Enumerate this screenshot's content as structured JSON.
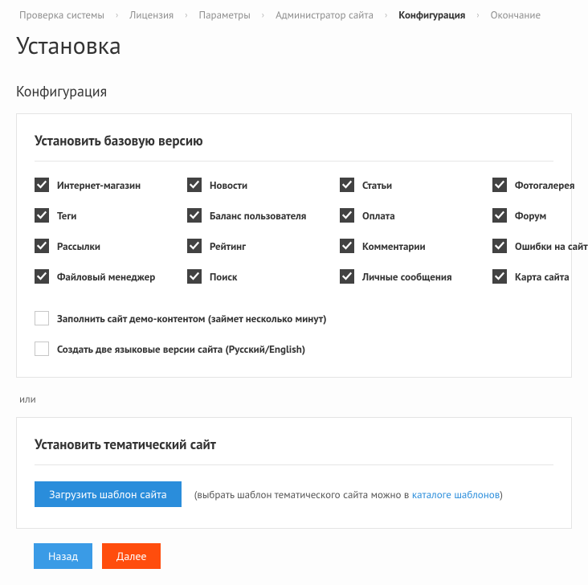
{
  "breadcrumb": [
    {
      "label": "Проверка системы",
      "active": false
    },
    {
      "label": "Лицензия",
      "active": false
    },
    {
      "label": "Параметры",
      "active": false
    },
    {
      "label": "Администратор сайта",
      "active": false
    },
    {
      "label": "Конфигурация",
      "active": true
    },
    {
      "label": "Окончание",
      "active": false
    }
  ],
  "page_title": "Установка",
  "section_title": "Конфигурация",
  "base_panel": {
    "title": "Установить базовую версию",
    "modules": [
      {
        "label": "Интернет-магазин",
        "checked": true
      },
      {
        "label": "Новости",
        "checked": true
      },
      {
        "label": "Статьи",
        "checked": true
      },
      {
        "label": "Фотогалерея",
        "checked": true
      },
      {
        "label": "Теги",
        "checked": true
      },
      {
        "label": "Баланс пользователя",
        "checked": true
      },
      {
        "label": "Оплата",
        "checked": true
      },
      {
        "label": "Форум",
        "checked": true
      },
      {
        "label": "Рассылки",
        "checked": true
      },
      {
        "label": "Рейтинг",
        "checked": true
      },
      {
        "label": "Комментарии",
        "checked": true
      },
      {
        "label": "Ошибки на сайте",
        "checked": true
      },
      {
        "label": "Файловый менеджер",
        "checked": true
      },
      {
        "label": "Поиск",
        "checked": true
      },
      {
        "label": "Личные сообщения",
        "checked": true
      },
      {
        "label": "Карта сайта",
        "checked": true
      }
    ],
    "extra": [
      {
        "label": "Заполнить сайт демо-контентом (займет несколько минут)",
        "checked": false
      },
      {
        "label": "Создать две языковые версии сайта (Русский/English)",
        "checked": false
      }
    ]
  },
  "or_label": "или",
  "theme_panel": {
    "title": "Установить тематический сайт",
    "button": "Загрузить шаблон сайта",
    "hint_prefix": "(выбрать шаблон тематического сайта можно в ",
    "hint_link": "каталоге шаблонов",
    "hint_suffix": ")"
  },
  "nav": {
    "back": "Назад",
    "next": "Далее"
  }
}
